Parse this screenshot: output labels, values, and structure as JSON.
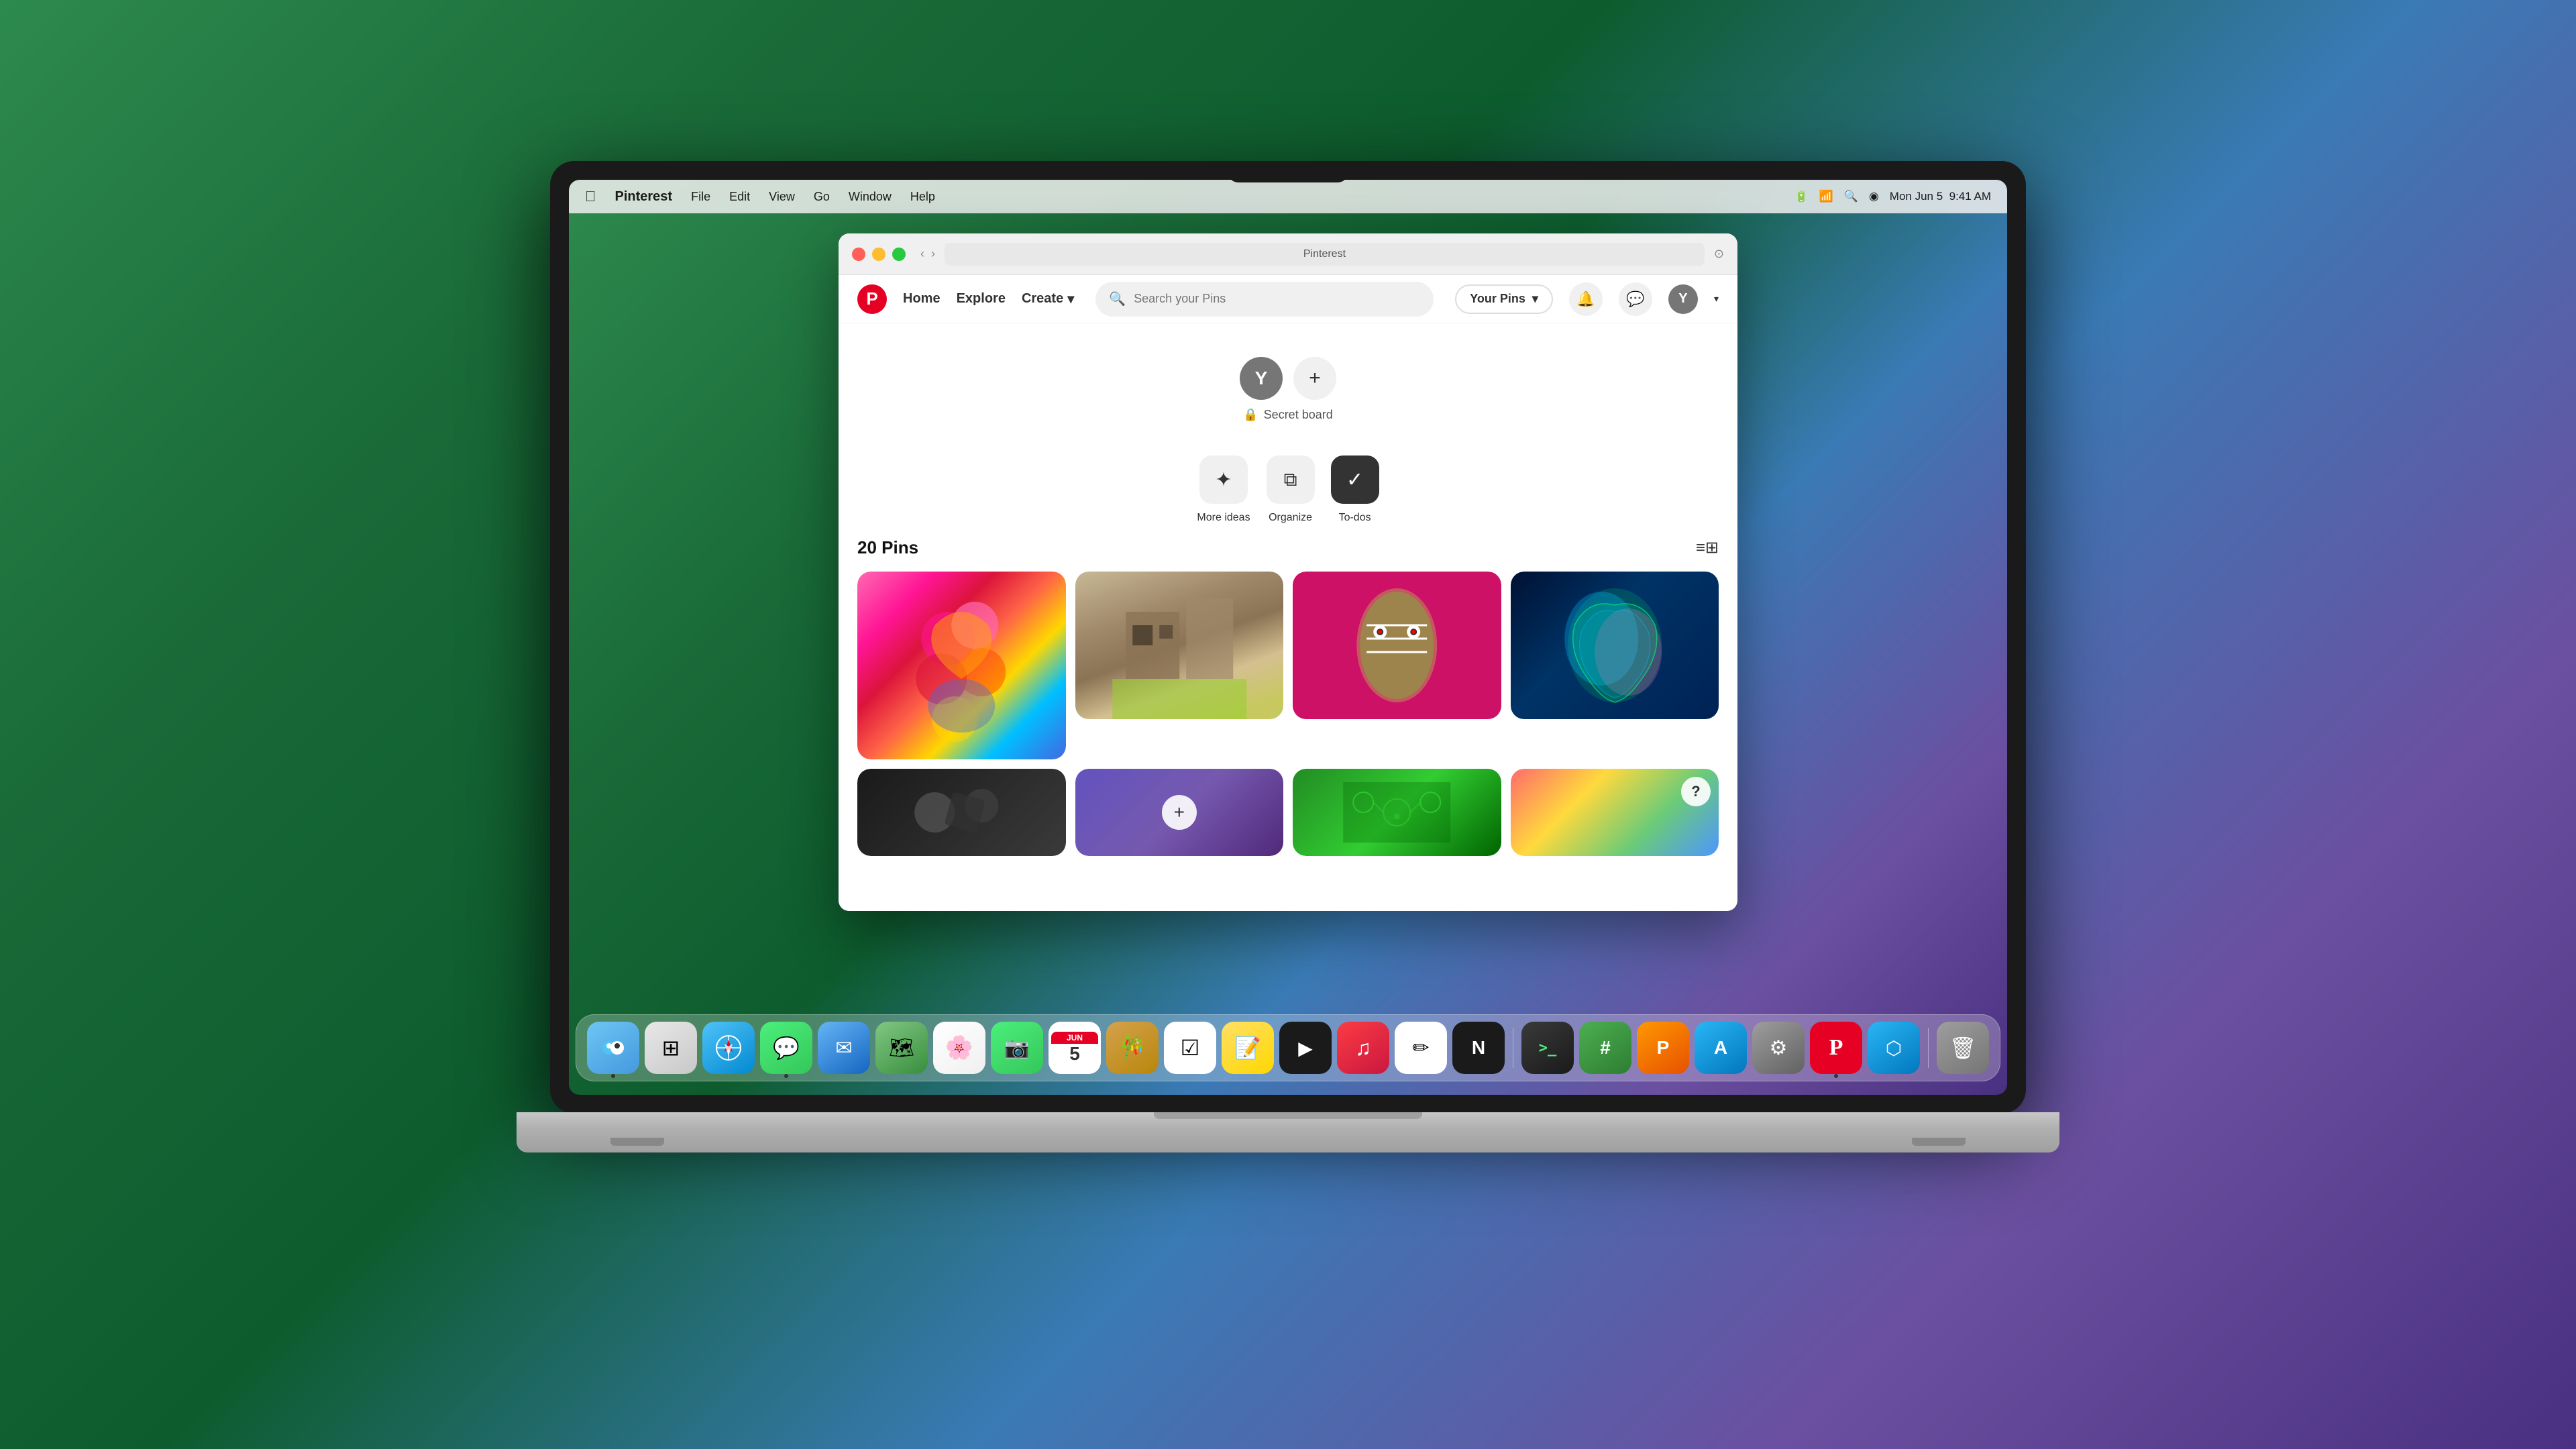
{
  "macbook": {
    "screen_title": "Pinterest"
  },
  "menubar": {
    "apple": "&#63743;",
    "app_name": "Pinterest",
    "items": [
      "File",
      "Edit",
      "View",
      "Go",
      "Window",
      "Help"
    ],
    "right_items": [
      "Mon Jun 5",
      "9:41 AM"
    ]
  },
  "browser": {
    "title": "Pinterest",
    "nav": {
      "back": "‹",
      "forward": "›"
    },
    "address": "Pinterest"
  },
  "pinterest": {
    "nav": {
      "home_label": "Home",
      "explore_label": "Explore",
      "create_label": "Create",
      "search_placeholder": "Search your Pins",
      "your_pins_label": "Your Pins",
      "notification_icon": "🔔",
      "message_icon": "💬",
      "user_initial": "Y"
    },
    "board": {
      "user_initial": "Y",
      "add_label": "+",
      "lock_icon": "🔒",
      "secret_label": "Secret board"
    },
    "actions": [
      {
        "id": "more-ideas",
        "icon": "✦",
        "label": "More ideas"
      },
      {
        "id": "organize",
        "icon": "⧉",
        "label": "Organize"
      },
      {
        "id": "to-dos",
        "icon": "✓",
        "label": "To-dos"
      }
    ],
    "pins": {
      "count_label": "20 Pins",
      "filter_icon": "⚙",
      "grid": [
        {
          "id": "pin-1",
          "type": "colorful-flowers",
          "height": "tall"
        },
        {
          "id": "pin-2",
          "type": "room-scene",
          "height": "medium"
        },
        {
          "id": "pin-3",
          "type": "red-mask",
          "height": "medium"
        },
        {
          "id": "pin-4",
          "type": "3d-blob",
          "height": "medium"
        },
        {
          "id": "pin-5",
          "type": "dark-mech",
          "height": "short",
          "has_add": false
        },
        {
          "id": "pin-6",
          "type": "purple-grad",
          "height": "short",
          "has_add": true
        },
        {
          "id": "pin-7",
          "type": "green-circuit",
          "height": "short",
          "has_add": false
        },
        {
          "id": "pin-8",
          "type": "colorful-paint",
          "height": "short",
          "has_question": true
        }
      ]
    }
  },
  "dock": {
    "items": [
      {
        "id": "finder",
        "label": "Finder",
        "icon": "🔵",
        "class": "di-finder",
        "dot": true
      },
      {
        "id": "launchpad",
        "label": "Launchpad",
        "icon": "⊞",
        "class": "di-launchpad"
      },
      {
        "id": "safari",
        "label": "Safari",
        "icon": "⬤",
        "class": "di-safari"
      },
      {
        "id": "messages",
        "label": "Messages",
        "icon": "💬",
        "class": "di-messages",
        "dot": true
      },
      {
        "id": "mail",
        "label": "Mail",
        "icon": "✉",
        "class": "di-mail"
      },
      {
        "id": "maps",
        "label": "Maps",
        "icon": "📍",
        "class": "di-maps"
      },
      {
        "id": "photos",
        "label": "Photos",
        "icon": "❋",
        "class": "di-photos"
      },
      {
        "id": "facetime",
        "label": "FaceTime",
        "icon": "📷",
        "class": "di-facetime"
      },
      {
        "id": "calendar",
        "label": "Calendar",
        "icon": "5",
        "class": "di-calendar",
        "calendar_month": "JUN",
        "calendar_day": "5"
      },
      {
        "id": "bamboo",
        "label": "Keka",
        "icon": "🎋",
        "class": "di-bamboo"
      },
      {
        "id": "reminders",
        "label": "Reminders",
        "icon": "☑",
        "class": "di-reminders"
      },
      {
        "id": "notes",
        "label": "Notes",
        "icon": "📝",
        "class": "di-notes"
      },
      {
        "id": "appletv",
        "label": "Apple TV",
        "icon": "▶",
        "class": "di-appletv"
      },
      {
        "id": "music",
        "label": "Music",
        "icon": "♫",
        "class": "di-music"
      },
      {
        "id": "freeform",
        "label": "Freeform",
        "icon": "✏",
        "class": "di-freeform"
      },
      {
        "id": "news",
        "label": "News",
        "icon": "N",
        "class": "di-news"
      },
      {
        "id": "terminal",
        "label": "Terminal",
        "icon": ">_",
        "class": "di-terminal"
      },
      {
        "id": "numbers",
        "label": "Numbers",
        "icon": "#",
        "class": "di-numbers"
      },
      {
        "id": "pages",
        "label": "Pages",
        "icon": "P",
        "class": "di-pages"
      },
      {
        "id": "appstore",
        "label": "App Store",
        "icon": "A",
        "class": "di-appstore"
      },
      {
        "id": "settings",
        "label": "System Settings",
        "icon": "⚙",
        "class": "di-settings"
      },
      {
        "id": "pinterest",
        "label": "Pinterest",
        "icon": "P",
        "class": "di-pinterest",
        "dot": true
      },
      {
        "id": "proxy",
        "label": "Proxyman",
        "icon": "⬡",
        "class": "di-proxy"
      },
      {
        "id": "trash",
        "label": "Trash",
        "icon": "🗑",
        "class": "di-trash"
      }
    ]
  }
}
